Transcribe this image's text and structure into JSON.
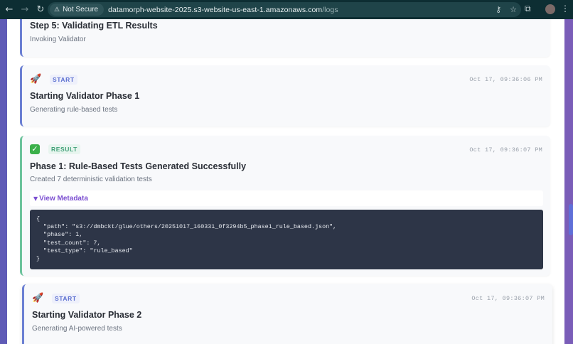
{
  "browser": {
    "security_label": "Not Secure",
    "url_host": "datamorph-website-2025.s3-website-us-east-1.amazonaws.com",
    "url_path": "/logs"
  },
  "cards": [
    {
      "title": "Step 5: Validating ETL Results",
      "subtitle": "Invoking Validator"
    },
    {
      "type": "START",
      "icon": "rocket-icon",
      "timestamp": "Oct 17, 09:36:06 PM",
      "title": "Starting Validator Phase 1",
      "subtitle": "Generating rule-based tests"
    },
    {
      "type": "RESULT",
      "icon": "check-icon",
      "timestamp": "Oct 17, 09:36:07 PM",
      "title": "Phase 1: Rule-Based Tests Generated Successfully",
      "subtitle": "Created 7 deterministic validation tests",
      "metadata_toggle": "View Metadata",
      "metadata_json": "{\n  \"path\": \"s3://dmbckt/glue/others/20251017_160331_0f3294b5_phase1_rule_based.json\",\n  \"phase\": 1,\n  \"test_count\": 7,\n  \"test_type\": \"rule_based\"\n}"
    },
    {
      "type": "START",
      "icon": "rocket-icon",
      "timestamp": "Oct 17, 09:36:07 PM",
      "title": "Starting Validator Phase 2",
      "subtitle": "Generating AI-powered tests"
    }
  ],
  "colors": {
    "start_accent": "#6b7fd3",
    "result_accent": "#6cc39c",
    "metadata_link": "#7b4ed1"
  }
}
